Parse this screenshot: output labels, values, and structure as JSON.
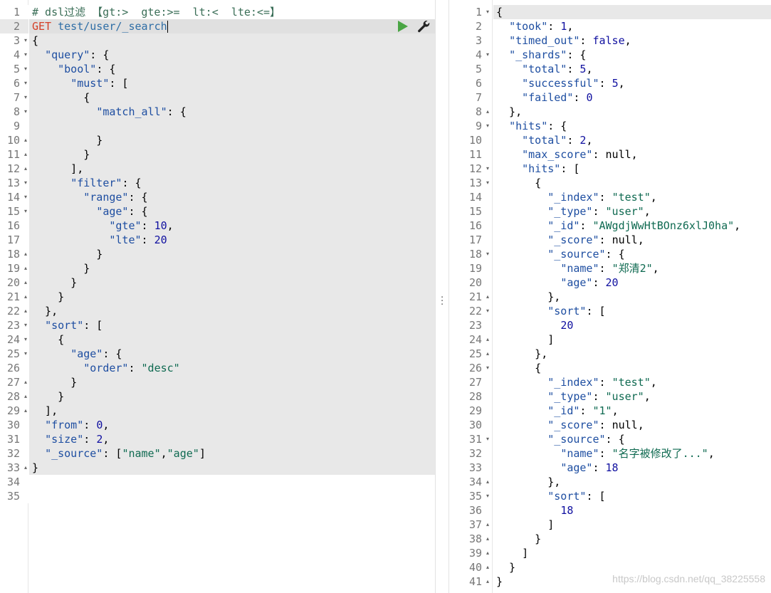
{
  "request_editor": {
    "comment": "# dsl过滤 【gt:>  gte:>=  lt:<  lte:<=】",
    "method": "GET",
    "url": "test/user/_search",
    "line_numbers": [
      "1",
      "2",
      "3",
      "4",
      "5",
      "6",
      "7",
      "8",
      "9",
      "10",
      "11",
      "12",
      "13",
      "14",
      "15",
      "16",
      "17",
      "18",
      "19",
      "20",
      "21",
      "22",
      "23",
      "24",
      "25",
      "26",
      "27",
      "28",
      "29",
      "30",
      "31",
      "32",
      "33",
      "34",
      "35"
    ],
    "lines": [
      "{",
      "  \"query\": {",
      "    \"bool\": {",
      "      \"must\": [",
      "        {",
      "          \"match_all\": {",
      "",
      "          }",
      "        }",
      "      ],",
      "      \"filter\": {",
      "        \"range\": {",
      "          \"age\": {",
      "            \"gte\": 10,",
      "            \"lte\": 20",
      "          }",
      "        }",
      "      }",
      "    }",
      "  },",
      "  \"sort\": [",
      "    {",
      "      \"age\": {",
      "        \"order\": \"desc\"",
      "      }",
      "    }",
      "  ],",
      "  \"from\": 0,",
      "  \"size\": 2,",
      "  \"_source\": [\"name\",\"age\"]",
      "}"
    ]
  },
  "response_viewer": {
    "line_numbers": [
      "1",
      "2",
      "3",
      "4",
      "5",
      "6",
      "7",
      "8",
      "9",
      "10",
      "11",
      "12",
      "13",
      "14",
      "15",
      "16",
      "17",
      "18",
      "19",
      "20",
      "21",
      "22",
      "23",
      "24",
      "25",
      "26",
      "27",
      "28",
      "29",
      "30",
      "31",
      "32",
      "33",
      "34",
      "35",
      "36",
      "37",
      "38",
      "39",
      "40",
      "41"
    ],
    "lines": [
      "{",
      "  \"took\": 1,",
      "  \"timed_out\": false,",
      "  \"_shards\": {",
      "    \"total\": 5,",
      "    \"successful\": 5,",
      "    \"failed\": 0",
      "  },",
      "  \"hits\": {",
      "    \"total\": 2,",
      "    \"max_score\": null,",
      "    \"hits\": [",
      "      {",
      "        \"_index\": \"test\",",
      "        \"_type\": \"user\",",
      "        \"_id\": \"AWgdjWwHtBOnz6xlJ0ha\",",
      "        \"_score\": null,",
      "        \"_source\": {",
      "          \"name\": \"郑清2\",",
      "          \"age\": 20",
      "        },",
      "        \"sort\": [",
      "          20",
      "        ]",
      "      },",
      "      {",
      "        \"_index\": \"test\",",
      "        \"_type\": \"user\",",
      "        \"_id\": \"1\",",
      "        \"_score\": null,",
      "        \"_source\": {",
      "          \"name\": \"名字被修改了...\",",
      "          \"age\": 18",
      "        },",
      "        \"sort\": [",
      "          18",
      "        ]",
      "      }",
      "    ]",
      "  }",
      "}"
    ]
  },
  "icons": {
    "run": "play-icon",
    "settings": "wrench-icon",
    "resize": "vertical-dots-icon"
  },
  "colors": {
    "run_green": "#4aa544",
    "method_red": "#d43f27",
    "key_blue": "#1e4ea1",
    "string_green": "#0f6a51",
    "number_blue": "#1010a0"
  },
  "watermark": "https://blog.csdn.net/qq_38225558"
}
